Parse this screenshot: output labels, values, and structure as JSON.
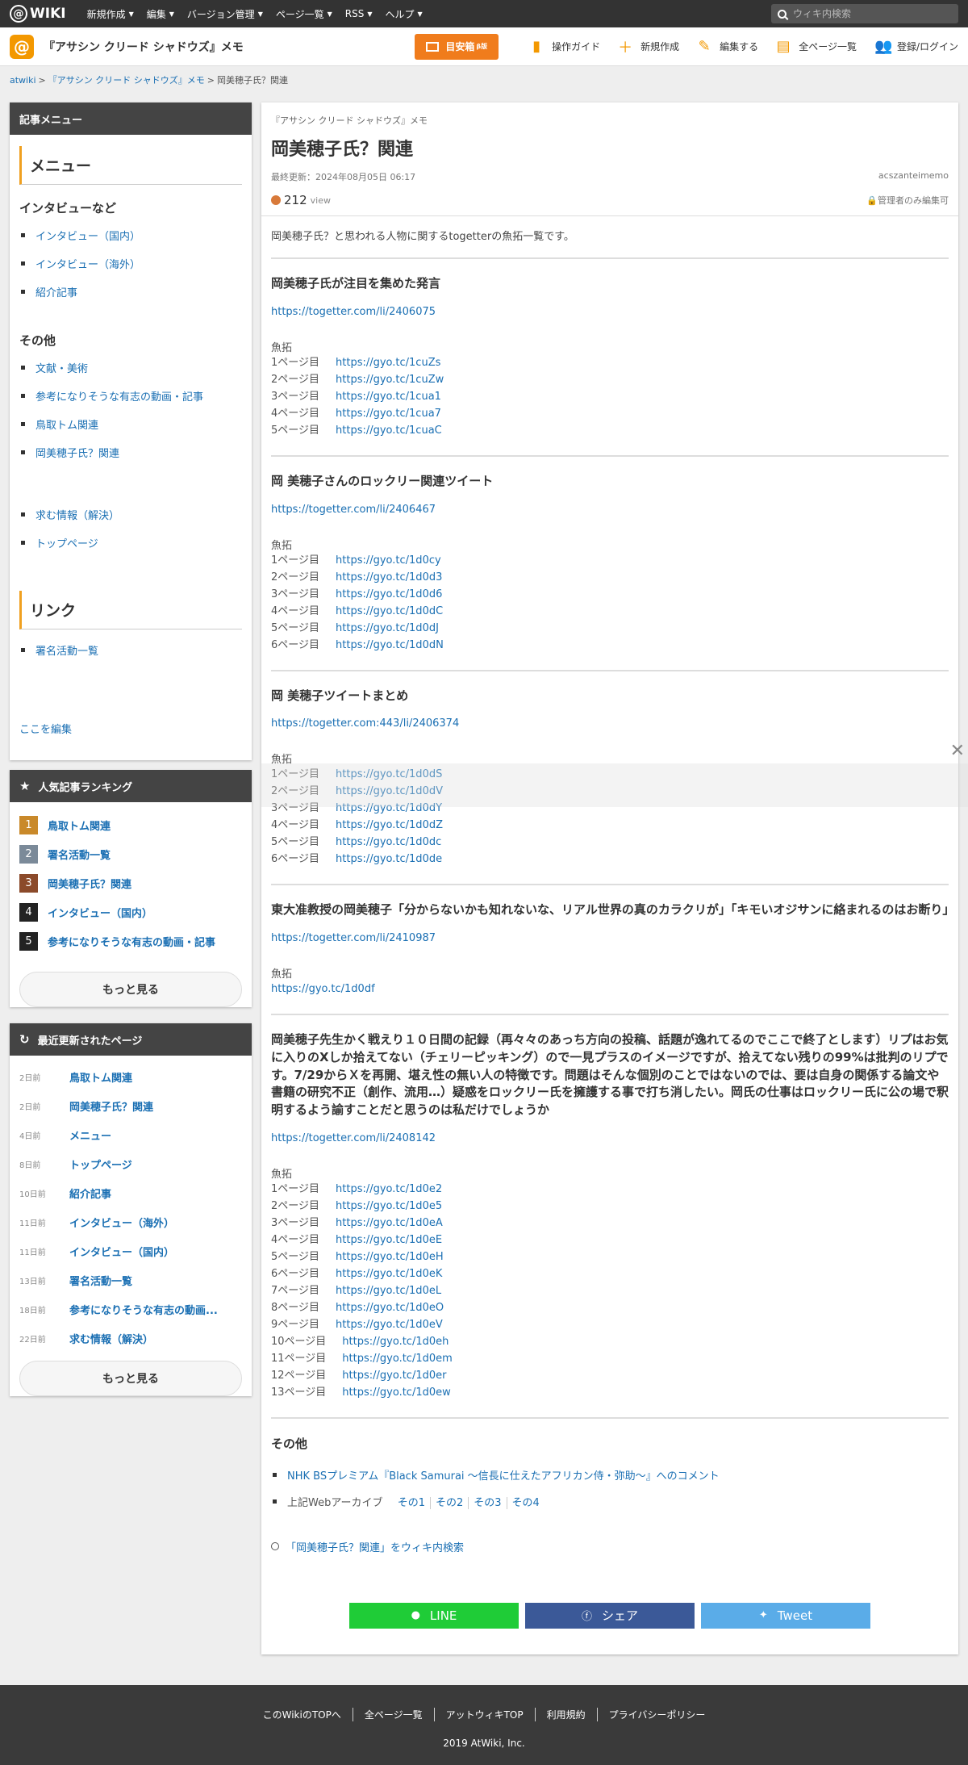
{
  "topbar": {
    "logo": "WIKI",
    "nav": [
      "新規作成",
      "編集",
      "バージョン管理",
      "ページ一覧",
      "RSS",
      "ヘルプ"
    ],
    "search_placeholder": "ウィキ内検索"
  },
  "wikihead": {
    "title": "『アサシン クリード シャドウズ』メモ",
    "meyasu_label": "目安箱",
    "meyasu_badge": "β版",
    "actions": [
      "操作ガイド",
      "新規作成",
      "編集する",
      "全ページ一覧",
      "登録/ログイン"
    ]
  },
  "breadcrumb": [
    "atwiki",
    "『アサシン クリード シャドウズ』メモ",
    "岡美穂子氏？関連"
  ],
  "sidebar": {
    "menu_title": "記事メニュー",
    "menu_h2": "メニュー",
    "sec1_title": "インタビューなど",
    "sec1_items": [
      "インタビュー（国内）",
      "インタビュー（海外）",
      "紹介記事"
    ],
    "sec2_title": "その他",
    "sec2_items": [
      "文献・美術",
      "参考になりそうな有志の動画・記事",
      "鳥取トム関連",
      "岡美穂子氏？関連"
    ],
    "sec3_items": [
      "求む情報（解決）",
      "トップページ"
    ],
    "links_h2": "リンク",
    "links_items": [
      "署名活動一覧"
    ],
    "edit_here": "ここを編集",
    "ranking_title": "人気記事ランキング",
    "ranking": [
      {
        "num": "1",
        "label": "鳥取トム関連",
        "color": "#c9892a"
      },
      {
        "num": "2",
        "label": "署名活動一覧",
        "color": "#7b8a99"
      },
      {
        "num": "3",
        "label": "岡美穂子氏？関連",
        "color": "#8b4a2a"
      },
      {
        "num": "4",
        "label": "インタビュー（国内）",
        "color": "#222222"
      },
      {
        "num": "5",
        "label": "参考になりそうな有志の動画・記事",
        "color": "#222222"
      }
    ],
    "more": "もっと見る",
    "recent_title": "最近更新されたページ",
    "recent": [
      {
        "ago": "2日前",
        "label": "鳥取トム関連"
      },
      {
        "ago": "2日前",
        "label": "岡美穂子氏？関連"
      },
      {
        "ago": "4日前",
        "label": "メニュー"
      },
      {
        "ago": "8日前",
        "label": "トップページ"
      },
      {
        "ago": "10日前",
        "label": "紹介記事"
      },
      {
        "ago": "11日前",
        "label": "インタビュー（海外）"
      },
      {
        "ago": "11日前",
        "label": "インタビュー（国内）"
      },
      {
        "ago": "13日前",
        "label": "署名活動一覧"
      },
      {
        "ago": "18日前",
        "label": "参考になりそうな有志の動画..."
      },
      {
        "ago": "22日前",
        "label": "求む情報（解決）"
      }
    ]
  },
  "article": {
    "site": "『アサシン クリード シャドウズ』メモ",
    "title": "岡美穂子氏？関連",
    "updated": "最終更新：2024年08月05日 06:17",
    "author": "acszanteimemo",
    "views": "212",
    "views_unit": "view",
    "lock": "管理者のみ編集可",
    "intro": "岡美穂子氏？と思われる人物に関するtogetterの魚拓一覧です。",
    "gyo_label": "魚拓",
    "sections": [
      {
        "title": "岡美穂子氏が注目を集めた発言",
        "link": "https://togetter.com/li/2406075",
        "rows": [
          [
            "1ページ目",
            "https://gyo.tc/1cuZs"
          ],
          [
            "2ページ目",
            "https://gyo.tc/1cuZw"
          ],
          [
            "3ページ目",
            "https://gyo.tc/1cua1"
          ],
          [
            "4ページ目",
            "https://gyo.tc/1cua7"
          ],
          [
            "5ページ目",
            "https://gyo.tc/1cuaC"
          ]
        ]
      },
      {
        "title": "岡 美穂子さんのロックリー関連ツイート",
        "link": "https://togetter.com/li/2406467",
        "rows": [
          [
            "1ページ目",
            "https://gyo.tc/1d0cy"
          ],
          [
            "2ページ目",
            "https://gyo.tc/1d0d3"
          ],
          [
            "3ページ目",
            "https://gyo.tc/1d0d6"
          ],
          [
            "4ページ目",
            "https://gyo.tc/1d0dC"
          ],
          [
            "5ページ目",
            "https://gyo.tc/1d0dJ"
          ],
          [
            "6ページ目",
            "https://gyo.tc/1d0dN"
          ]
        ]
      },
      {
        "title": "岡 美穂子ツイートまとめ",
        "link": "https://togetter.com:443/li/2406374",
        "rows": [
          [
            "1ページ目",
            "https://gyo.tc/1d0dS"
          ],
          [
            "2ページ目",
            "https://gyo.tc/1d0dV"
          ],
          [
            "3ページ目",
            "https://gyo.tc/1d0dY"
          ],
          [
            "4ページ目",
            "https://gyo.tc/1d0dZ"
          ],
          [
            "5ページ目",
            "https://gyo.tc/1d0dc"
          ],
          [
            "6ページ目",
            "https://gyo.tc/1d0de"
          ]
        ]
      },
      {
        "title": "東大准教授の岡美穂子「分からないかも知れないな、リアル世界の真のカラクリが」「キモいオジサンに絡まれるのはお断り」",
        "link": "https://togetter.com/li/2410987",
        "rows": [
          [
            "",
            "https://gyo.tc/1d0df"
          ]
        ]
      },
      {
        "title": "岡美穂子先生かく戦えり１０日間の記録（再々々のあっち方向の投稿、話題が逸れてるのでここで終了とします）リプはお気に入りのXしか拾えてない（チェリーピッキング）ので一見プラスのイメージですが、拾えてない残りの99%は批判のリプです。7/29からＸを再開、堪え性の無い人の特徴です。問題はそんな個別のことではないのでは、要は自身の関係する論文や書籍の研究不正（創作、流用…）疑惑をロックリー氏を擁護する事で打ち消したい。岡氏の仕事はロックリー氏に公の場で釈明するよう諭すことだと思うのは私だけでしょうか",
        "link": "https://togetter.com/li/2408142",
        "rows": [
          [
            "1ページ目",
            "https://gyo.tc/1d0e2"
          ],
          [
            "2ページ目",
            "https://gyo.tc/1d0e5"
          ],
          [
            "3ページ目",
            "https://gyo.tc/1d0eA"
          ],
          [
            "4ページ目",
            "https://gyo.tc/1d0eE"
          ],
          [
            "5ページ目",
            "https://gyo.tc/1d0eH"
          ],
          [
            "6ページ目",
            "https://gyo.tc/1d0eK"
          ],
          [
            "7ページ目",
            "https://gyo.tc/1d0eL"
          ],
          [
            "8ページ目",
            "https://gyo.tc/1d0eO"
          ],
          [
            "9ページ目",
            "https://gyo.tc/1d0eV"
          ],
          [
            "10ページ目",
            "https://gyo.tc/1d0eh"
          ],
          [
            "11ページ目",
            "https://gyo.tc/1d0em"
          ],
          [
            "12ページ目",
            "https://gyo.tc/1d0er"
          ],
          [
            "13ページ目",
            "https://gyo.tc/1d0ew"
          ]
        ]
      }
    ],
    "other_title": "その他",
    "other_item1": "NHK BSプレミアム『Black Samurai 〜信長に仕えたアフリカン侍・弥助〜』へのコメント",
    "other_item2_prefix": "上記Webアーカイブ",
    "archives": [
      "その1",
      "その2",
      "その3",
      "その4"
    ],
    "wiki_search": "「岡美穂子氏？関連」をウィキ内検索",
    "share": [
      {
        "label": "LINE",
        "color": "#1fcc37"
      },
      {
        "label": "シェア",
        "color": "#3b5998"
      },
      {
        "label": "Tweet",
        "color": "#5aace8"
      }
    ]
  },
  "footer": {
    "links": [
      "このWikiのTOPへ",
      "全ページ一覧",
      "アットウィキTOP",
      "利用規約",
      "プライバシーポリシー"
    ],
    "copyright": "2019 AtWiki, Inc."
  }
}
